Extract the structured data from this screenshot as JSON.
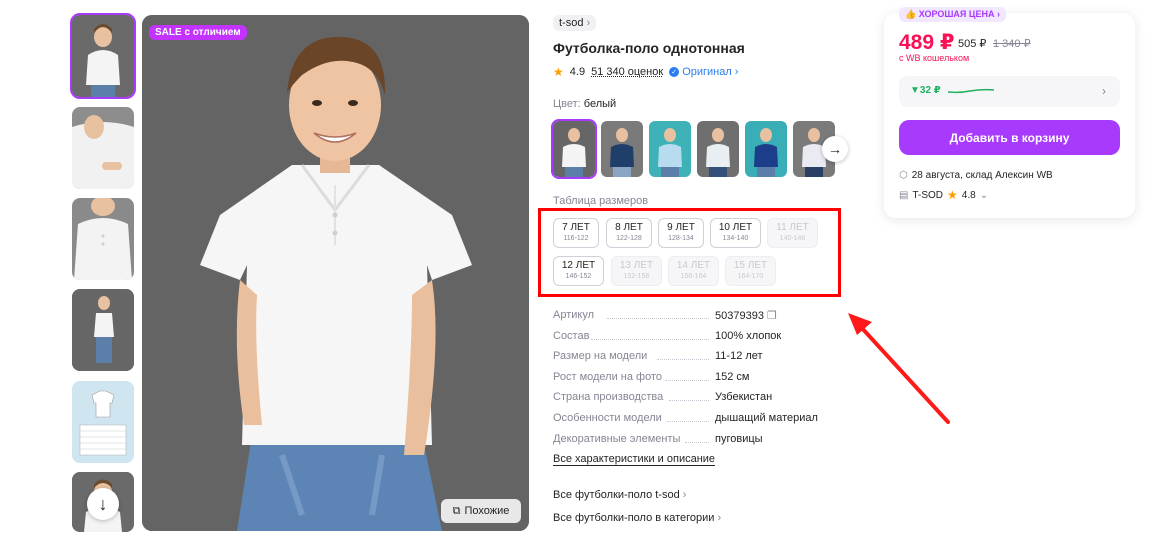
{
  "gallery": {
    "sale_badge": "SALE с отличием",
    "similar_label": "Похожие",
    "thumb_count": 6
  },
  "product": {
    "brand": "t-sod",
    "title": "Футболка-поло однотонная",
    "rating": "4.9",
    "reviews": "51 340 оценок",
    "original": "Оригинал",
    "color_label": "Цвет:",
    "color_value": "белый"
  },
  "sizes": {
    "title": "Таблица размеров",
    "items": [
      {
        "size": "7 ЛЕТ",
        "range": "116-122",
        "available": true
      },
      {
        "size": "8 ЛЕТ",
        "range": "122-128",
        "available": true
      },
      {
        "size": "9 ЛЕТ",
        "range": "128-134",
        "available": true
      },
      {
        "size": "10 ЛЕТ",
        "range": "134-140",
        "available": true
      },
      {
        "size": "11 ЛЕТ",
        "range": "140-146",
        "available": false
      },
      {
        "size": "12 ЛЕТ",
        "range": "146-152",
        "available": true
      },
      {
        "size": "13 ЛЕТ",
        "range": "152-158",
        "available": false
      },
      {
        "size": "14 ЛЕТ",
        "range": "158-164",
        "available": false
      },
      {
        "size": "15 ЛЕТ",
        "range": "164-170",
        "available": false
      }
    ]
  },
  "characteristics": [
    {
      "label": "Артикул",
      "value": "50379393"
    },
    {
      "label": "Состав",
      "value": "100% хлопок"
    },
    {
      "label": "Размер на модели",
      "value": "11-12 лет"
    },
    {
      "label": "Рост модели на фото",
      "value": "152 см"
    },
    {
      "label": "Страна производства",
      "value": "Узбекистан"
    },
    {
      "label": "Особенности модели",
      "value": "дышащий материал"
    },
    {
      "label": "Декоративные элементы",
      "value": "пуговицы"
    }
  ],
  "links": {
    "all_chars": "Все характеристики и описание",
    "brand_link": "Все футболки-поло t-sod",
    "category_link": "Все футболки-поло в категории"
  },
  "price_card": {
    "good_price": "ХОРОШАЯ ЦЕНА",
    "price": "489 ₽",
    "old_price": "505 ₽",
    "strike_price": "1 340 ₽",
    "wallet": "с WB кошельком",
    "drop": "▼32 ₽",
    "add_button": "Добавить в корзину",
    "delivery": "28 августа, склад Алексин WB",
    "seller": "T-SOD",
    "seller_rating": "4.8"
  },
  "colors": {
    "accent": "#a73afd",
    "price": "#f91155",
    "highlight": "#ff0000",
    "link": "#2b7cf0"
  }
}
